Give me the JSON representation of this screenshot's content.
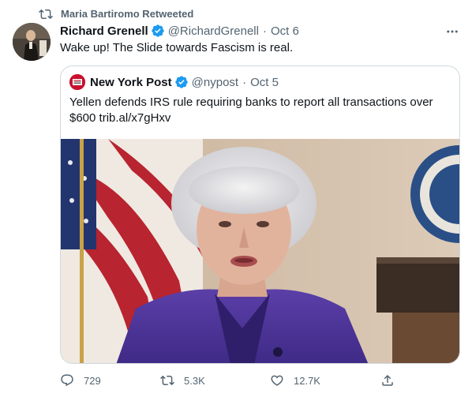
{
  "retweet": {
    "text": "Maria Bartiromo Retweeted"
  },
  "tweet": {
    "name": "Richard Grenell",
    "handle": "@RichardGrenell",
    "separator": "·",
    "time": "Oct 6",
    "text": "Wake up! The Slide towards Fascism is real."
  },
  "quote": {
    "name": "New York Post",
    "handle": "@nypost",
    "separator": "·",
    "time": "Oct 5",
    "text": "Yellen defends IRS rule requiring banks to report all transactions over $600 trib.al/x7gHxv"
  },
  "actions": {
    "replies": "729",
    "retweets": "5.3K",
    "likes": "12.7K"
  },
  "colors": {
    "text": "#0f1419",
    "secondary": "#536471",
    "verified": "#1d9bf0",
    "border": "#cfd9de",
    "nypost": "#c8102e"
  },
  "icons": [
    "retweet-icon",
    "verified-badge-icon",
    "more-icon",
    "reply-icon",
    "heart-icon",
    "share-icon"
  ]
}
